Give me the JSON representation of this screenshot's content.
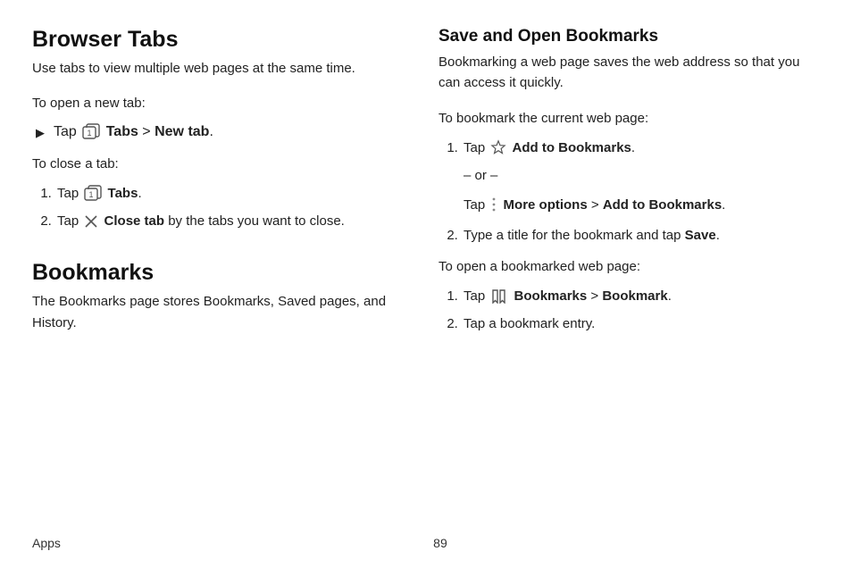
{
  "left": {
    "h_browser_tabs": "Browser Tabs",
    "browser_tabs_desc": "Use tabs to view multiple web pages at the same time.",
    "to_open_new_tab": "To open a new tab:",
    "tap1_a": "Tap ",
    "tap1_b_bold": "Tabs",
    "tap1_sep": " > ",
    "tap1_c_bold": "New tab",
    "to_close_tab": "To close a tab:",
    "close_step1_a": "Tap ",
    "close_step1_b_bold": "Tabs",
    "close_step2_a": "Tap ",
    "close_step2_b_bold": "Close tab",
    "close_step2_c": " by the tabs you want to close.",
    "h_bookmarks": "Bookmarks",
    "bookmarks_desc": "The Bookmarks page stores Bookmarks, Saved pages, and History."
  },
  "right": {
    "h_save_open": "Save and Open Bookmarks",
    "save_desc": "Bookmarking a web page saves the web address so that you can access it quickly.",
    "to_bookmark_current": "To bookmark the current web page:",
    "bm_step1_a": "Tap ",
    "bm_step1_b_bold": "Add to Bookmarks",
    "or_text": "– or –",
    "bm_alt_a": "Tap ",
    "bm_alt_b_bold": "More options",
    "bm_alt_sep": " > ",
    "bm_alt_c_bold": "Add to Bookmarks",
    "bm_step2_a": "Type a title for the bookmark and tap ",
    "bm_step2_b_bold": "Save",
    "to_open_bookmarked": "To open a bookmarked web page:",
    "open_step1_a": "Tap ",
    "open_step1_b_bold": "Bookmarks",
    "open_step1_sep": " > ",
    "open_step1_c_bold": "Bookmark",
    "open_step2": "Tap a bookmark entry."
  },
  "footer": {
    "section": "Apps",
    "page": "89"
  }
}
